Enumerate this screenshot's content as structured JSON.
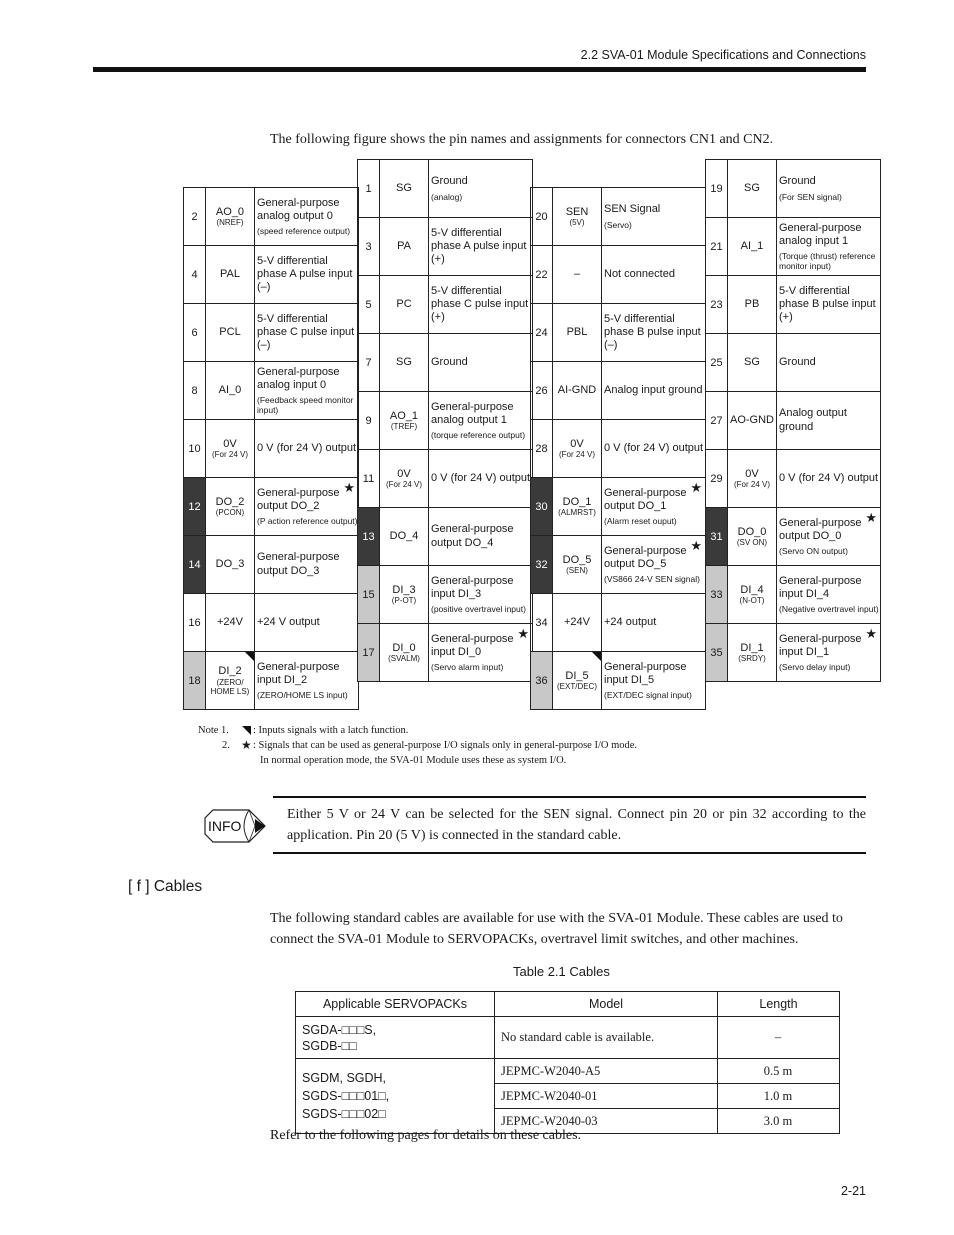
{
  "header": {
    "section_title": "2.2  SVA-01 Module Specifications and Connections"
  },
  "intro": "The following figure shows the pin names and assignments for connectors CN1 and CN2.",
  "pin_columns": [
    {
      "rows": [
        {
          "pin": "2",
          "name": "AO_0",
          "alt": "(NREF)",
          "desc": "General-purpose analog output 0",
          "note": "(speed reference output)",
          "shade": "",
          "star": false,
          "latch": false
        },
        {
          "pin": "4",
          "name": "PAL",
          "alt": "",
          "desc": "5-V differential phase A pulse input (–)",
          "note": "",
          "shade": "",
          "star": false,
          "latch": false
        },
        {
          "pin": "6",
          "name": "PCL",
          "alt": "",
          "desc": "5-V differential phase C pulse input (–)",
          "note": "",
          "shade": "",
          "star": false,
          "latch": false
        },
        {
          "pin": "8",
          "name": "AI_0",
          "alt": "",
          "desc": "General-purpose analog input 0",
          "note": "(Feedback speed monitor input)",
          "shade": "",
          "star": false,
          "latch": false
        },
        {
          "pin": "10",
          "name": "0V",
          "alt": "(For 24 V)",
          "desc": "0 V (for 24 V)  output",
          "note": "",
          "shade": "",
          "star": false,
          "latch": false
        },
        {
          "pin": "12",
          "name": "DO_2",
          "alt": "(PCON)",
          "desc": "General-purpose output DO_2",
          "note": "(P action reference output)",
          "shade": "dark",
          "star": true,
          "latch": false
        },
        {
          "pin": "14",
          "name": "DO_3",
          "alt": "",
          "desc": "General-purpose output DO_3",
          "note": "",
          "shade": "dark",
          "star": false,
          "latch": false
        },
        {
          "pin": "16",
          "name": "+24V",
          "alt": "",
          "desc": "+24 V output",
          "note": "",
          "shade": "",
          "star": false,
          "latch": false
        },
        {
          "pin": "18",
          "name": "DI_2",
          "alt": "(ZERO/ HOME LS)",
          "desc": "General-purpose input DI_2",
          "note": "(ZERO/HOME LS  input)",
          "shade": "light",
          "star": false,
          "latch": true
        }
      ]
    },
    {
      "rows": [
        {
          "pin": "1",
          "name": "SG",
          "alt": "",
          "desc": "Ground",
          "note": "(analog)",
          "shade": "",
          "star": false,
          "latch": false
        },
        {
          "pin": "3",
          "name": "PA",
          "alt": "",
          "desc": "5-V differential phase A pulse input (+)",
          "note": "",
          "shade": "",
          "star": false,
          "latch": false
        },
        {
          "pin": "5",
          "name": "PC",
          "alt": "",
          "desc": "5-V differential phase C pulse input (+)",
          "note": "",
          "shade": "",
          "star": false,
          "latch": false
        },
        {
          "pin": "7",
          "name": "SG",
          "alt": "",
          "desc": "Ground",
          "note": "",
          "shade": "",
          "star": false,
          "latch": false
        },
        {
          "pin": "9",
          "name": "AO_1",
          "alt": "(TREF)",
          "desc": "General-purpose analog output 1",
          "note": "(torque reference output)",
          "shade": "",
          "star": false,
          "latch": false
        },
        {
          "pin": "11",
          "name": "0V",
          "alt": "(For 24 V)",
          "desc": "0 V (for 24 V) output",
          "note": "",
          "shade": "",
          "star": false,
          "latch": false
        },
        {
          "pin": "13",
          "name": "DO_4",
          "alt": "",
          "desc": "General-purpose output DO_4",
          "note": "",
          "shade": "dark",
          "star": false,
          "latch": false
        },
        {
          "pin": "15",
          "name": "DI_3",
          "alt": "(P-OT)",
          "desc": "General-purpose input DI_3",
          "note": "(positive overtravel input)",
          "shade": "light",
          "star": false,
          "latch": false
        },
        {
          "pin": "17",
          "name": "DI_0",
          "alt": "(SVALM)",
          "desc": "General-purpose input DI_0",
          "note": "(Servo alarm input)",
          "shade": "light",
          "star": true,
          "latch": false
        }
      ]
    },
    {
      "rows": [
        {
          "pin": "20",
          "name": "SEN",
          "alt": "(5V)",
          "desc": "SEN Signal",
          "note": "(Servo)",
          "shade": "",
          "star": false,
          "latch": false
        },
        {
          "pin": "22",
          "name": "–",
          "alt": "",
          "desc": "Not connected",
          "note": "",
          "shade": "",
          "star": false,
          "latch": false
        },
        {
          "pin": "24",
          "name": "PBL",
          "alt": "",
          "desc": "5-V differential phase B pulse input (–)",
          "note": "",
          "shade": "",
          "star": false,
          "latch": false
        },
        {
          "pin": "26",
          "name": "AI-GND",
          "alt": "",
          "desc": "Analog input ground",
          "note": "",
          "shade": "",
          "star": false,
          "latch": false
        },
        {
          "pin": "28",
          "name": "0V",
          "alt": "(For 24 V)",
          "desc": "0 V (for 24 V) output",
          "note": "",
          "shade": "",
          "star": false,
          "latch": false
        },
        {
          "pin": "30",
          "name": "DO_1",
          "alt": "(ALMRST)",
          "desc": "General-purpose output DO_1",
          "note": "(Alarm reset ouput)",
          "shade": "dark",
          "star": true,
          "latch": false
        },
        {
          "pin": "32",
          "name": "DO_5",
          "alt": "(SEN)",
          "desc": "General-purpose output DO_5",
          "note": "(VS866 24-V SEN signal)",
          "shade": "dark",
          "star": true,
          "latch": false
        },
        {
          "pin": "34",
          "name": "+24V",
          "alt": "",
          "desc": "+24 output",
          "note": "",
          "shade": "",
          "star": false,
          "latch": false
        },
        {
          "pin": "36",
          "name": "DI_5",
          "alt": "(EXT/DEC)",
          "desc": "General-purpose input DI_5",
          "note": "(EXT/DEC signal input)",
          "shade": "light",
          "star": false,
          "latch": true
        }
      ]
    },
    {
      "rows": [
        {
          "pin": "19",
          "name": "SG",
          "alt": "",
          "desc": "Ground",
          "note": "(For SEN signal)",
          "shade": "",
          "star": false,
          "latch": false
        },
        {
          "pin": "21",
          "name": "AI_1",
          "alt": "",
          "desc": "General-purpose analog input 1",
          "note": "(Torque (thrust) reference monitor input)",
          "shade": "",
          "star": false,
          "latch": false
        },
        {
          "pin": "23",
          "name": "PB",
          "alt": "",
          "desc": "5-V differential phase B pulse input (+)",
          "note": "",
          "shade": "",
          "star": false,
          "latch": false
        },
        {
          "pin": "25",
          "name": "SG",
          "alt": "",
          "desc": "Ground",
          "note": "",
          "shade": "",
          "star": false,
          "latch": false
        },
        {
          "pin": "27",
          "name": "AO-GND",
          "alt": "",
          "desc": "Analog output ground",
          "note": "",
          "shade": "",
          "star": false,
          "latch": false
        },
        {
          "pin": "29",
          "name": "0V",
          "alt": "(For 24 V)",
          "desc": "0 V (for 24 V) output",
          "note": "",
          "shade": "",
          "star": false,
          "latch": false
        },
        {
          "pin": "31",
          "name": "DO_0",
          "alt": "(SV ON)",
          "desc": "General-purpose output DO_0",
          "note": "(Servo ON output)",
          "shade": "dark",
          "star": true,
          "latch": false
        },
        {
          "pin": "33",
          "name": "DI_4",
          "alt": "(N-OT)",
          "desc": "General-purpose input DI_4",
          "note": "(Negative overtravel input)",
          "shade": "light",
          "star": false,
          "latch": false
        },
        {
          "pin": "35",
          "name": "DI_1",
          "alt": "(SRDY)",
          "desc": "General-purpose input DI_1",
          "note": "(Servo delay input)",
          "shade": "light",
          "star": true,
          "latch": false
        }
      ]
    }
  ],
  "notes": {
    "label": "Note 1.",
    "num2": "2.",
    "latch_symbol": "latch-triangle-icon",
    "star_symbol": "★",
    "note1": ": Inputs signals with a latch function.",
    "note2a": ": Signals that can be used as general-purpose I/O signals only in general-purpose I/O mode.",
    "note2b": "In normal operation mode, the SVA-01 Module uses these as system I/O."
  },
  "info": {
    "icon_label": "INFO",
    "text": "Either 5 V or 24 V can be selected for the SEN signal. Connect pin 20 or pin 32 according to the application. Pin 20 (5 V) is connected in the standard cable."
  },
  "section": {
    "heading": "[ f ]   Cables",
    "body": "The following standard cables are available for use with the SVA-01 Module. These cables are used to connect the SVA-01 Module to SERVOPACKs, overtravel limit switches, and other machines.",
    "table_caption": "Table 2.1  Cables"
  },
  "cables_table": {
    "headers": [
      "Applicable SERVOPACKs",
      "Model",
      "Length"
    ],
    "group1": {
      "servopacks": [
        "SGDA-□□□S,",
        "SGDB-□□"
      ],
      "model": "No standard cable is available.",
      "length": "–"
    },
    "group2": {
      "servopacks": [
        "SGDM, SGDH,",
        "SGDS-□□□01□,",
        "SGDS-□□□02□"
      ],
      "rows": [
        {
          "model": "JEPMC-W2040-A5",
          "length": "0.5 m"
        },
        {
          "model": "JEPMC-W2040-01",
          "length": "1.0 m"
        },
        {
          "model": "JEPMC-W2040-03",
          "length": "3.0 m"
        }
      ]
    }
  },
  "refer": "Refer to the following pages for details on these cables.",
  "page_number": "2-21"
}
